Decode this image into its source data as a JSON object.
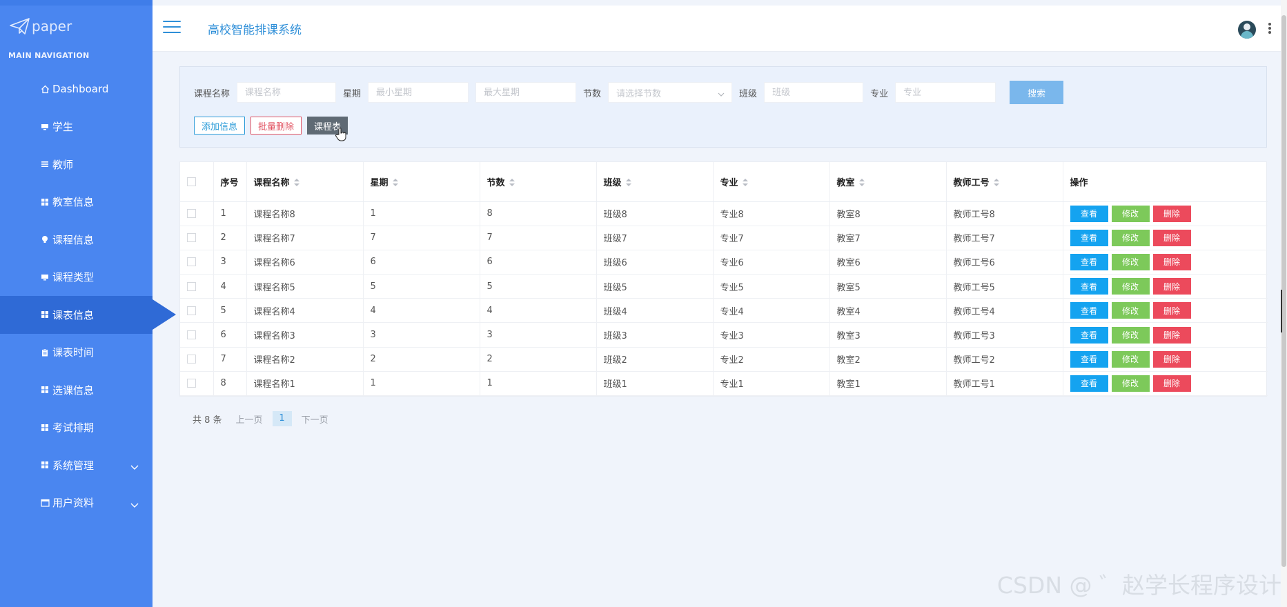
{
  "app": {
    "logo_text": "paper",
    "title": "高校智能排课系统"
  },
  "sidebar": {
    "header": "MAIN NAVIGATION",
    "items": [
      {
        "label": "Dashboard",
        "icon": "home-icon"
      },
      {
        "label": "学生",
        "icon": "monitor-icon"
      },
      {
        "label": "教师",
        "icon": "list-icon"
      },
      {
        "label": "教室信息",
        "icon": "grid-icon"
      },
      {
        "label": "课程信息",
        "icon": "bulb-icon"
      },
      {
        "label": "课程类型",
        "icon": "monitor-icon"
      },
      {
        "label": "课表信息",
        "icon": "grid-icon",
        "active": true
      },
      {
        "label": "课表时间",
        "icon": "clipboard-icon"
      },
      {
        "label": "选课信息",
        "icon": "grid-icon"
      },
      {
        "label": "考试排期",
        "icon": "grid-icon"
      },
      {
        "label": "系统管理",
        "icon": "grid-icon",
        "expandable": true
      },
      {
        "label": "用户资料",
        "icon": "calendar-icon",
        "expandable": true
      }
    ]
  },
  "search": {
    "course_name_label": "课程名称",
    "course_name_placeholder": "课程名称",
    "weekday_label": "星期",
    "min_weekday_placeholder": "最小星期",
    "max_weekday_placeholder": "最大星期",
    "period_label": "节数",
    "period_placeholder": "请选择节数",
    "class_label": "班级",
    "class_placeholder": "班级",
    "major_label": "专业",
    "major_placeholder": "专业",
    "search_button": "搜索"
  },
  "actions": {
    "add": "添加信息",
    "batch_delete": "批量删除",
    "schedule": "课程表"
  },
  "table": {
    "columns": [
      "序号",
      "课程名称",
      "星期",
      "节数",
      "班级",
      "专业",
      "教室",
      "教师工号",
      "操作"
    ],
    "op_labels": {
      "view": "查看",
      "edit": "修改",
      "delete": "删除"
    },
    "rows": [
      {
        "idx": "1",
        "name": "课程名称8",
        "weekday": "1",
        "period": "8",
        "class": "班级8",
        "major": "专业8",
        "room": "教室8",
        "teacher": "教师工号8"
      },
      {
        "idx": "2",
        "name": "课程名称7",
        "weekday": "7",
        "period": "7",
        "class": "班级7",
        "major": "专业7",
        "room": "教室7",
        "teacher": "教师工号7"
      },
      {
        "idx": "3",
        "name": "课程名称6",
        "weekday": "6",
        "period": "6",
        "class": "班级6",
        "major": "专业6",
        "room": "教室6",
        "teacher": "教师工号6"
      },
      {
        "idx": "4",
        "name": "课程名称5",
        "weekday": "5",
        "period": "5",
        "class": "班级5",
        "major": "专业5",
        "room": "教室5",
        "teacher": "教师工号5"
      },
      {
        "idx": "5",
        "name": "课程名称4",
        "weekday": "4",
        "period": "4",
        "class": "班级4",
        "major": "专业4",
        "room": "教室4",
        "teacher": "教师工号4"
      },
      {
        "idx": "6",
        "name": "课程名称3",
        "weekday": "3",
        "period": "3",
        "class": "班级3",
        "major": "专业3",
        "room": "教室3",
        "teacher": "教师工号3"
      },
      {
        "idx": "7",
        "name": "课程名称2",
        "weekday": "2",
        "period": "2",
        "class": "班级2",
        "major": "专业2",
        "room": "教室2",
        "teacher": "教师工号2"
      },
      {
        "idx": "8",
        "name": "课程名称1",
        "weekday": "1",
        "period": "1",
        "class": "班级1",
        "major": "专业1",
        "room": "教室1",
        "teacher": "教师工号1"
      }
    ]
  },
  "pager": {
    "total": "共 8 条",
    "prev": "上一页",
    "current": "1",
    "next": "下一页"
  },
  "watermark": "CSDN @ ゛赵学长程序设计",
  "colors": {
    "sidebar_bg": "#4a86f0",
    "sidebar_active": "#2f6ad6",
    "accent": "#2f8fd8",
    "view": "#14a3f0",
    "edit": "#7dc95a",
    "delete": "#ec4a5c"
  }
}
